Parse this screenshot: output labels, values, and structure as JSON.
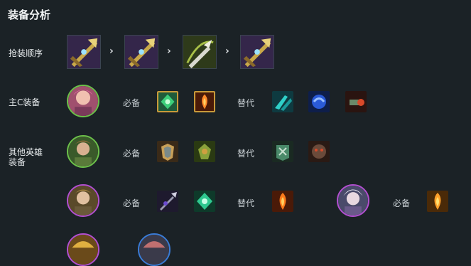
{
  "section_title": "装备分析",
  "rows": {
    "build_order_label": "抢装顺序",
    "main_carry_label": "主C装备",
    "other_heroes_label_line1": "其他英雄",
    "other_heroes_label_line2": "装备"
  },
  "tags": {
    "required": "必备",
    "alternative": "替代"
  },
  "separator": "›",
  "colors": {
    "background": "#1b2226",
    "avatar_green": "#6cc04a",
    "avatar_purple": "#b24fd0",
    "avatar_blue": "#3a7bd5"
  },
  "icons": {
    "build_order": [
      "spear-of-shojin-icon",
      "spear-of-shojin-icon",
      "component-bow-sword-icon",
      "spear-of-shojin-icon"
    ],
    "main_required": [
      "emerald-crest-icon",
      "flame-bow-icon"
    ],
    "main_alt": [
      "teal-blades-icon",
      "blue-gauntlet-icon",
      "crimson-cannon-icon"
    ],
    "other1_required": [
      "golden-armor-icon",
      "thorny-crest-icon"
    ],
    "other1_alt": [
      "jade-vest-icon",
      "iron-mask-icon"
    ],
    "other2_required": [
      "spear-tip-icon",
      "emerald-crest-icon"
    ],
    "other2_alt": [
      "flame-bow-icon"
    ],
    "other3_required": [
      "flame-bow-icon"
    ]
  }
}
